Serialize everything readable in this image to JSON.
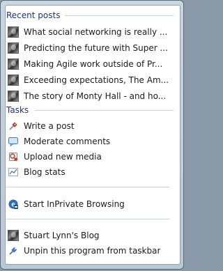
{
  "sections": {
    "recent": {
      "header": "Recent posts",
      "items": [
        {
          "label": "What social networking is really ...",
          "icon": "post-thumbnail-icon"
        },
        {
          "label": "Predicting the future with Super ...",
          "icon": "post-thumbnail-icon"
        },
        {
          "label": "Making Agile work outside of Pr...",
          "icon": "post-thumbnail-icon"
        },
        {
          "label": "Exceeding expectations, The Am...",
          "icon": "post-thumbnail-icon"
        },
        {
          "label": "The story of Monty Hall - and ho...",
          "icon": "post-thumbnail-icon"
        }
      ]
    },
    "tasks": {
      "header": "Tasks",
      "items": [
        {
          "label": "Write a post",
          "icon": "pushpin-pen-icon"
        },
        {
          "label": "Moderate comments",
          "icon": "speech-bubble-icon"
        },
        {
          "label": "Upload new media",
          "icon": "media-upload-icon"
        },
        {
          "label": "Blog stats",
          "icon": "line-chart-icon"
        }
      ]
    },
    "browsing": {
      "label": "Start InPrivate Browsing",
      "icon": "inprivate-icon"
    },
    "footer": {
      "items": [
        {
          "label": "Stuart Lynn's Blog",
          "icon": "blog-thumbnail-icon"
        },
        {
          "label": "Unpin this program from taskbar",
          "icon": "unpin-icon"
        }
      ]
    }
  },
  "colors": {
    "header_text": "#1e3287",
    "item_text": "#1a1a1a",
    "separator": "#c5d0e0",
    "frame": "#b9c8d6"
  }
}
